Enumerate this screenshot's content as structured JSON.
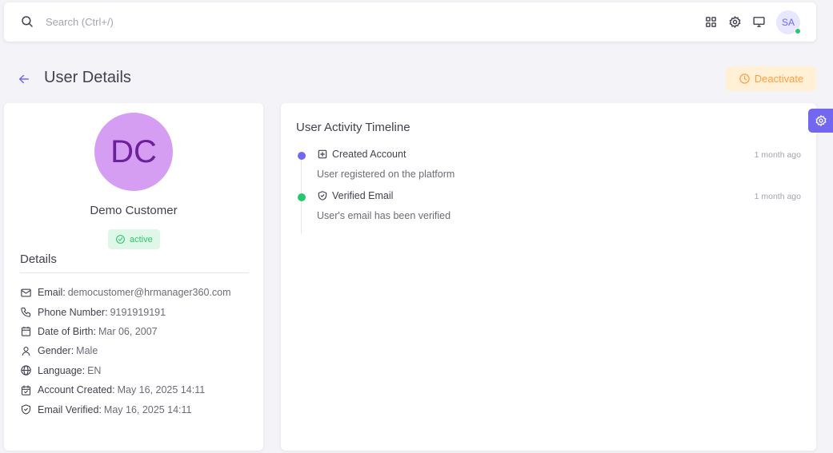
{
  "topbar": {
    "search_placeholder": "Search (Ctrl+/)",
    "avatar_initials": "SA"
  },
  "header": {
    "title": "User Details",
    "deactivate_label": "Deactivate"
  },
  "profile": {
    "initials": "DC",
    "name": "Demo Customer",
    "status": "active",
    "details_heading": "Details",
    "details": [
      {
        "icon": "mail-icon",
        "label": "Email:",
        "value": "democustomer@hrmanager360.com"
      },
      {
        "icon": "phone-icon",
        "label": "Phone Number:",
        "value": "9191919191"
      },
      {
        "icon": "calendar-icon",
        "label": "Date of Birth:",
        "value": "Mar 06, 2007"
      },
      {
        "icon": "user-icon",
        "label": "Gender:",
        "value": "Male"
      },
      {
        "icon": "globe-icon",
        "label": "Language:",
        "value": "EN"
      },
      {
        "icon": "calendar-check-icon",
        "label": "Account Created:",
        "value": "May 16, 2025 14:11"
      },
      {
        "icon": "shield-check-icon",
        "label": "Email Verified:",
        "value": "May 16, 2025 14:11"
      }
    ]
  },
  "timeline": {
    "title": "User Activity Timeline",
    "items": [
      {
        "title": "Created Account",
        "time": "1 month ago",
        "description": "User registered on the platform",
        "icon": "square-plus-icon",
        "dot_color": "#7367f0"
      },
      {
        "title": "Verified Email",
        "time": "1 month ago",
        "description": "User's email has been verified",
        "icon": "shield-check-icon",
        "dot_color": "#28c76f"
      }
    ]
  },
  "colors": {
    "primary": "#7367f0",
    "success": "#28c76f",
    "warning": "#ff9f43",
    "avatar_bg": "#d59ef3"
  }
}
